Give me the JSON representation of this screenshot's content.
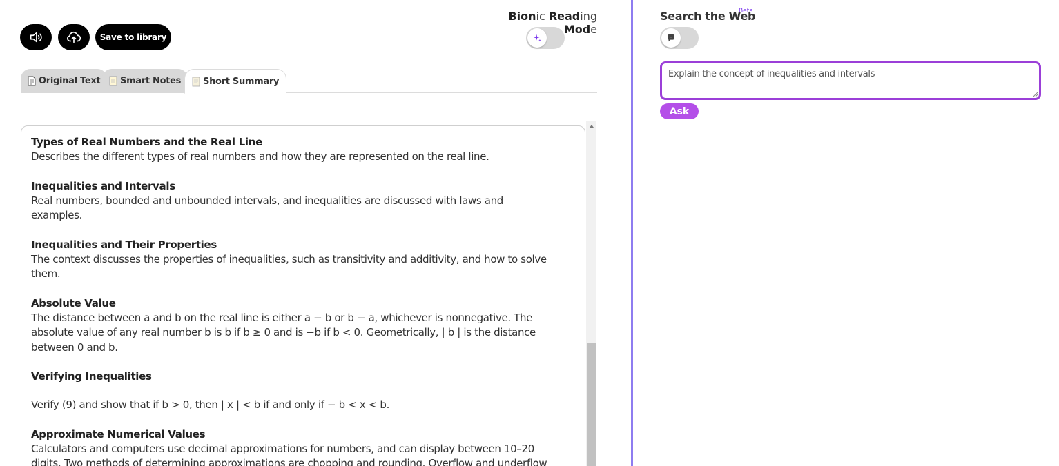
{
  "toolbar": {
    "save_label": "Save to library",
    "speaker_icon": "speaker-icon",
    "cloud_icon": "cloud-upload-icon"
  },
  "bionic": {
    "label_parts": [
      {
        "bold": "Bion",
        "rest": "ic "
      },
      {
        "bold": "Read",
        "rest": "ing "
      },
      {
        "bold": "Mod",
        "rest": "e"
      }
    ],
    "enabled": false
  },
  "tabs": [
    {
      "label": "Original Text",
      "active": false
    },
    {
      "label": "Smart Notes",
      "active": false
    },
    {
      "label": "Short Summary",
      "active": true
    }
  ],
  "summary": {
    "sections": [
      {
        "title": "Types of Real Numbers and the Real Line",
        "body": "Describes the different types of real numbers and how they are represented on the real line."
      },
      {
        "title": "Inequalities and Intervals",
        "body": "Real numbers, bounded and unbounded intervals, and inequalities are discussed with laws and examples."
      },
      {
        "title": "Inequalities and Their Properties",
        "body": "The context discusses the properties of inequalities, such as transitivity and additivity, and how to solve them."
      },
      {
        "title": "Absolute Value",
        "body": "The distance between a and b on the real line is either a − b or b − a, whichever is nonnegative. The absolute value of any real number b is b if b ≥ 0 and is −b if b < 0. Geometrically, | b | is the distance between 0 and b."
      },
      {
        "title": "Verifying Inequalities",
        "body": "Verify (9) and show that if b > 0, then | x | < b if and only if − b < x < b."
      },
      {
        "title": "Approximate Numerical Values",
        "body": "Calculators and computers use decimal approximations for numbers, and can display between 10–20 digits. Two methods of determining approximations are chopping and rounding. Overflow and underflow can lead to erroneous results."
      }
    ]
  },
  "search": {
    "label": "Search the Web",
    "beta": "Beta",
    "enabled": false,
    "query": "Explain the concept of inequalities and intervals",
    "ask_label": "Ask"
  },
  "colors": {
    "accent": "#9b3fd8",
    "ask_button": "#b44fe8",
    "divider": "#8e7cf0"
  }
}
